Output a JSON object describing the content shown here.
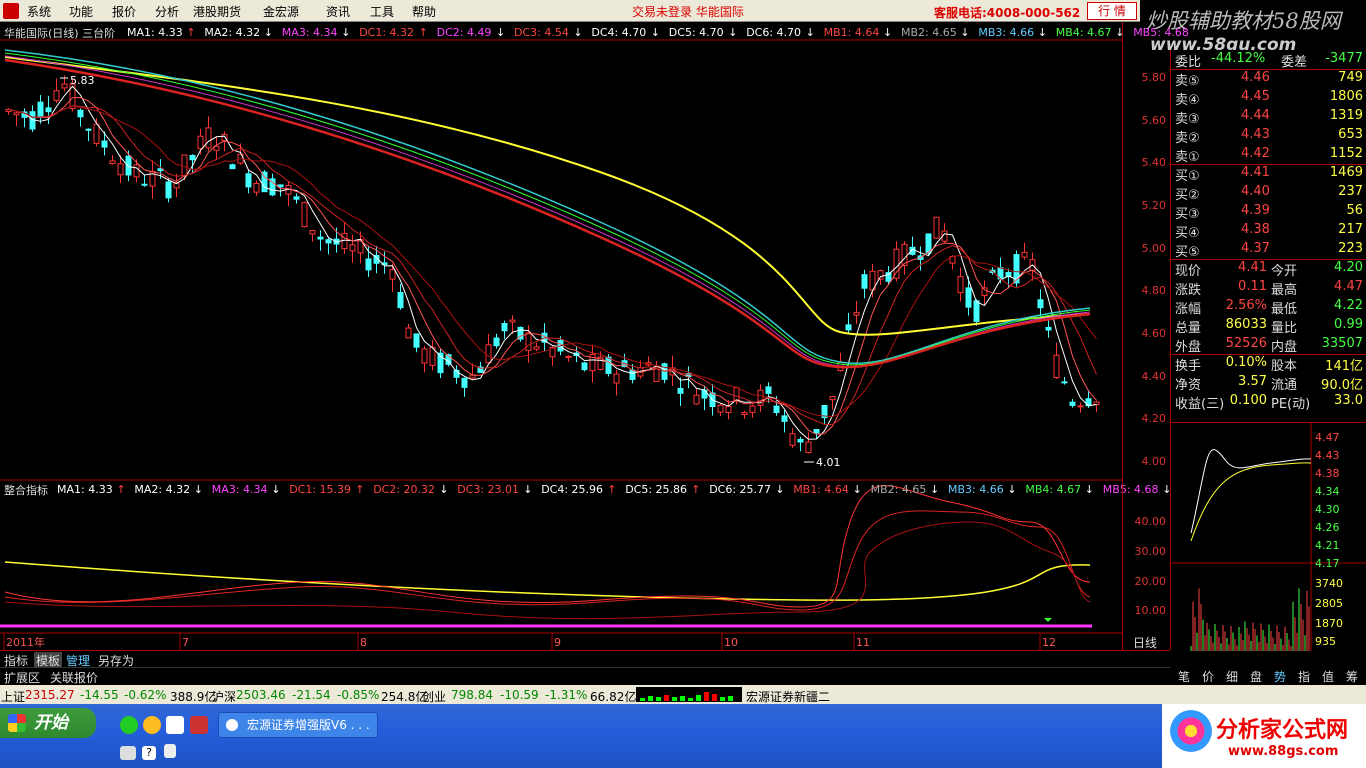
{
  "menubar": {
    "items": [
      "系统",
      "功能",
      "报价",
      "分析",
      "港股期货",
      "金宏源",
      "资讯",
      "工具",
      "帮助"
    ],
    "notice": "交易未登录 华能国际",
    "hotline": "客服电话:4008-000-562",
    "quote_button": "行 情"
  },
  "watermark": {
    "line1": "炒股辅助教材58股网",
    "line2": "www.58gu.com"
  },
  "chart": {
    "title": "华能国际(日线) 三台阶",
    "main_legend": [
      {
        "t": "MA1: 4.33",
        "c": "#ffffff",
        "a": "↑"
      },
      {
        "t": "MA2: 4.32",
        "c": "#ffffff",
        "a": "↓"
      },
      {
        "t": "MA3: 4.34",
        "c": "#ff44ff",
        "a": "↓"
      },
      {
        "t": "DC1: 4.32",
        "c": "#ff4444",
        "a": "↑"
      },
      {
        "t": "DC2: 4.49",
        "c": "#ff44ff",
        "a": "↓"
      },
      {
        "t": "DC3: 4.54",
        "c": "#ff4444",
        "a": "↓"
      },
      {
        "t": "DC4: 4.70",
        "c": "#ffffff",
        "a": "↓"
      },
      {
        "t": "DC5: 4.70",
        "c": "#ffffff",
        "a": "↓"
      },
      {
        "t": "DC6: 4.70",
        "c": "#ffffff",
        "a": "↓"
      },
      {
        "t": "MB1: 4.64",
        "c": "#ff4444",
        "a": "↓"
      },
      {
        "t": "MB2: 4.65",
        "c": "#aaaaaa",
        "a": "↓"
      },
      {
        "t": "MB3: 4.66",
        "c": "#66ccff",
        "a": "↓"
      },
      {
        "t": "MB4: 4.67",
        "c": "#44ff44",
        "a": "↓"
      },
      {
        "t": "MB5: 4.68",
        "c": "#ff44ff",
        "a": ""
      }
    ],
    "high_label": "5.83",
    "low_label": "4.01",
    "sub_title": "整合指标",
    "sub_legend": [
      {
        "t": "MA1: 4.33",
        "c": "#ffffff",
        "a": "↑"
      },
      {
        "t": "MA2: 4.32",
        "c": "#ffffff",
        "a": "↓"
      },
      {
        "t": "MA3: 4.34",
        "c": "#ff44ff",
        "a": "↓"
      },
      {
        "t": "DC1: 15.39",
        "c": "#ff4444",
        "a": "↑"
      },
      {
        "t": "DC2: 20.32",
        "c": "#ff4444",
        "a": "↓"
      },
      {
        "t": "DC3: 23.01",
        "c": "#ff4444",
        "a": "↓"
      },
      {
        "t": "DC4: 25.96",
        "c": "#ffffff",
        "a": "↑"
      },
      {
        "t": "DC5: 25.86",
        "c": "#ffffff",
        "a": "↑"
      },
      {
        "t": "DC6: 25.77",
        "c": "#ffffff",
        "a": "↓"
      },
      {
        "t": "MB1: 4.64",
        "c": "#ff4444",
        "a": "↓"
      },
      {
        "t": "MB2: 4.65",
        "c": "#aaaaaa",
        "a": "↓"
      },
      {
        "t": "MB3: 4.66",
        "c": "#66ccff",
        "a": "↓"
      },
      {
        "t": "MB4: 4.67",
        "c": "#44ff44",
        "a": "↓"
      },
      {
        "t": "MB5: 4.68",
        "c": "#ff44ff",
        "a": "↓"
      }
    ],
    "price_ticks": [
      "5.80",
      "5.60",
      "5.40",
      "5.20",
      "5.00",
      "4.80",
      "4.60",
      "4.40",
      "4.20",
      "4.00"
    ],
    "sub_ticks": [
      "40.00",
      "30.00",
      "20.00",
      "10.00"
    ],
    "month_labels": [
      "2011年",
      "7",
      "8",
      "9",
      "10",
      "11",
      "12"
    ],
    "period": "日线",
    "zoom_buttons": [
      "+",
      "-",
      "□"
    ]
  },
  "quote": {
    "top": {
      "l1": "委比",
      "v1": "-44.12%",
      "l2": "委差",
      "v2": "-3477"
    },
    "asks": [
      {
        "label": "卖⑤",
        "price": "4.46",
        "vol": "749"
      },
      {
        "label": "卖④",
        "price": "4.45",
        "vol": "1806"
      },
      {
        "label": "卖③",
        "price": "4.44",
        "vol": "1319"
      },
      {
        "label": "卖②",
        "price": "4.43",
        "vol": "653"
      },
      {
        "label": "卖①",
        "price": "4.42",
        "vol": "1152"
      }
    ],
    "bids": [
      {
        "label": "买①",
        "price": "4.41",
        "vol": "1469"
      },
      {
        "label": "买②",
        "price": "4.40",
        "vol": "237"
      },
      {
        "label": "买③",
        "price": "4.39",
        "vol": "56"
      },
      {
        "label": "买④",
        "price": "4.38",
        "vol": "217"
      },
      {
        "label": "买⑤",
        "price": "4.37",
        "vol": "223"
      }
    ],
    "stats": [
      {
        "l1": "现价",
        "v1": "4.41",
        "c1": "#ff4444",
        "l2": "今开",
        "v2": "4.20",
        "c2": "#44ff44"
      },
      {
        "l1": "涨跌",
        "v1": "0.11",
        "c1": "#ff4444",
        "l2": "最高",
        "v2": "4.47",
        "c2": "#ff4444"
      },
      {
        "l1": "涨幅",
        "v1": "2.56%",
        "c1": "#ff4444",
        "l2": "最低",
        "v2": "4.22",
        "c2": "#44ff44"
      },
      {
        "l1": "总量",
        "v1": "86033",
        "c1": "#ffff44",
        "l2": "量比",
        "v2": "0.99",
        "c2": "#44ff44"
      },
      {
        "l1": "外盘",
        "v1": "52526",
        "c1": "#ff4444",
        "l2": "内盘",
        "v2": "33507",
        "c2": "#44ff44"
      }
    ],
    "fund": [
      {
        "l1": "换手",
        "v1": "0.10%",
        "l2": "股本",
        "v2": "141亿"
      },
      {
        "l1": "净资",
        "v1": "3.57",
        "l2": "流通",
        "v2": "90.0亿"
      },
      {
        "l1": "收益(三)",
        "v1": "0.100",
        "l2": "PE(动)",
        "v2": "33.0"
      }
    ]
  },
  "mini": {
    "price_ticks": [
      "4.47",
      "4.43",
      "4.38",
      "4.34",
      "4.30",
      "4.26",
      "4.21",
      "4.17"
    ],
    "vol_ticks": [
      "3740",
      "2805",
      "1870",
      "935"
    ]
  },
  "nav_buttons": [
    "笔",
    "价",
    "细",
    "盘",
    "势",
    "指",
    "值",
    "筹"
  ],
  "bottom_tabs": [
    "指标",
    "模板",
    "管理",
    "另存为"
  ],
  "bottom_tabs2": [
    "扩展区",
    "关联报价"
  ],
  "statusbar": {
    "sh": {
      "name": "上证",
      "price": "2315.27",
      "chg": "-14.55",
      "pct": "-0.62%",
      "amt": "388.9亿"
    },
    "hs": {
      "name": "沪深",
      "price": "2503.46",
      "chg": "-21.54",
      "pct": "-0.85%",
      "amt": "254.8亿"
    },
    "cy": {
      "name": "创业",
      "price": "798.84",
      "chg": "-10.59",
      "pct": "-1.31%",
      "amt": "66.82亿"
    },
    "broker": "宏源证券新疆二"
  },
  "taskbar": {
    "start": "开始",
    "task": "宏源证券增强版V6 . . ."
  },
  "brand": {
    "name": "分析家公式网",
    "url": "www.88gs.com"
  }
}
